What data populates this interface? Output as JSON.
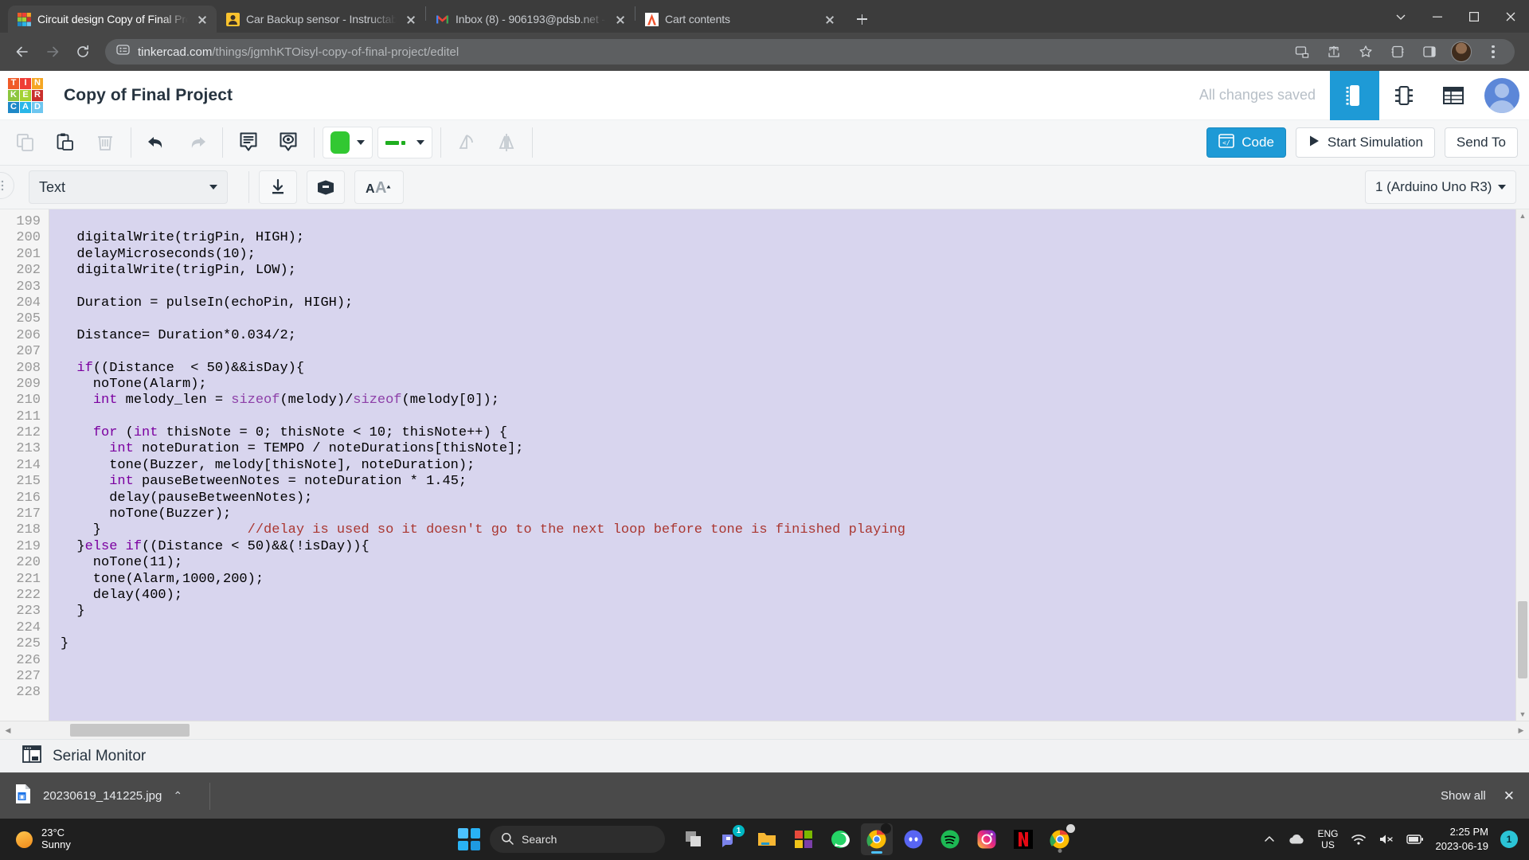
{
  "browser": {
    "tabs": [
      {
        "title": "Circuit design Copy of Final Proj",
        "favicon": "tinkercad-icon",
        "active": true
      },
      {
        "title": "Car Backup sensor - Instructable",
        "favicon": "instructables-icon",
        "active": false
      },
      {
        "title": "Inbox (8) - 906193@pdsb.net - ",
        "favicon": "gmail-icon",
        "active": false
      },
      {
        "title": "Cart contents",
        "favicon": "amazon-icon",
        "active": false
      }
    ],
    "url_domain": "tinkercad.com",
    "url_path": "/things/jgmhKTOisyl-copy-of-final-project/editel",
    "new_tab_label": "+",
    "controls": {
      "minimize": "–",
      "maximize": "□",
      "close": "✕",
      "more": "∨"
    }
  },
  "tinkercad": {
    "logo_letters": [
      "T",
      "I",
      "N",
      "K",
      "E",
      "R",
      "C",
      "A",
      "D"
    ],
    "logo_colors": [
      "#f05a28",
      "#ef3e36",
      "#f5a623",
      "#8cc63e",
      "#a4d233",
      "#c9302c",
      "#1e88c7",
      "#29b6e8",
      "#6ec6f0"
    ],
    "project_title": "Copy of Final Project",
    "save_status": "All changes saved",
    "view_buttons": [
      {
        "name": "components-view",
        "active": true
      },
      {
        "name": "circuit-view",
        "active": false
      },
      {
        "name": "list-view",
        "active": false
      }
    ],
    "toolbar": {
      "copy_label": "Copy",
      "paste_label": "Paste",
      "delete_label": "Delete",
      "undo_label": "Undo",
      "redo_label": "Redo",
      "notes_label": "Notes",
      "visibility_label": "Show/Hide",
      "color_value": "#32c832",
      "wire_color": "#1fae1f",
      "rotate_label": "Rotate",
      "mirror_label": "Mirror",
      "code_label": "Code",
      "start_simulation_label": "Start Simulation",
      "send_to_label": "Send To"
    },
    "code_toolbar": {
      "mode_value": "Text",
      "download_label": "Download Code",
      "library_label": "Libraries",
      "font_size_label": "Font Size",
      "board_value": "1 (Arduino Uno R3)"
    },
    "serial_monitor_label": "Serial Monitor"
  },
  "editor": {
    "accent_bg": "#d8d5ee",
    "first_line": 199,
    "lines": [
      {
        "n": 199,
        "tokens": []
      },
      {
        "n": 200,
        "tokens": [
          {
            "t": "  digitalWrite(trigPin, HIGH);",
            "c": "plain"
          }
        ]
      },
      {
        "n": 201,
        "tokens": [
          {
            "t": "  delayMicroseconds(10);",
            "c": "plain"
          }
        ]
      },
      {
        "n": 202,
        "tokens": [
          {
            "t": "  digitalWrite(trigPin, LOW);",
            "c": "plain"
          }
        ]
      },
      {
        "n": 203,
        "tokens": []
      },
      {
        "n": 204,
        "tokens": [
          {
            "t": "  Duration = pulseIn(echoPin, HIGH);",
            "c": "plain"
          }
        ]
      },
      {
        "n": 205,
        "tokens": []
      },
      {
        "n": 206,
        "tokens": [
          {
            "t": "  Distance= Duration*0.034/2;",
            "c": "plain"
          }
        ]
      },
      {
        "n": 207,
        "tokens": []
      },
      {
        "n": 208,
        "tokens": [
          {
            "t": "  ",
            "c": "plain"
          },
          {
            "t": "if",
            "c": "kw"
          },
          {
            "t": "((Distance  < 50)&&isDay){",
            "c": "plain"
          }
        ]
      },
      {
        "n": 209,
        "tokens": [
          {
            "t": "    noTone(Alarm);",
            "c": "plain"
          }
        ]
      },
      {
        "n": 210,
        "tokens": [
          {
            "t": "    ",
            "c": "plain"
          },
          {
            "t": "int",
            "c": "kw"
          },
          {
            "t": " melody_len = ",
            "c": "plain"
          },
          {
            "t": "sizeof",
            "c": "fn"
          },
          {
            "t": "(melody)",
            "c": "plain"
          },
          {
            "t": "/",
            "c": "plain"
          },
          {
            "t": "sizeof",
            "c": "fn"
          },
          {
            "t": "(melody[0]);",
            "c": "plain"
          }
        ]
      },
      {
        "n": 211,
        "tokens": []
      },
      {
        "n": 212,
        "tokens": [
          {
            "t": "    ",
            "c": "plain"
          },
          {
            "t": "for",
            "c": "kw"
          },
          {
            "t": " (",
            "c": "plain"
          },
          {
            "t": "int",
            "c": "kw"
          },
          {
            "t": " thisNote = 0; thisNote < 10; thisNote++) {",
            "c": "plain"
          }
        ]
      },
      {
        "n": 213,
        "tokens": [
          {
            "t": "      ",
            "c": "plain"
          },
          {
            "t": "int",
            "c": "kw"
          },
          {
            "t": " noteDuration = TEMPO / noteDurations[thisNote];",
            "c": "plain"
          }
        ]
      },
      {
        "n": 214,
        "tokens": [
          {
            "t": "      tone(Buzzer, melody[thisNote], noteDuration);",
            "c": "plain"
          }
        ]
      },
      {
        "n": 215,
        "tokens": [
          {
            "t": "      ",
            "c": "plain"
          },
          {
            "t": "int",
            "c": "kw"
          },
          {
            "t": " pauseBetweenNotes = noteDuration * 1.45;",
            "c": "plain"
          }
        ]
      },
      {
        "n": 216,
        "tokens": [
          {
            "t": "      delay(pauseBetweenNotes);",
            "c": "plain"
          }
        ]
      },
      {
        "n": 217,
        "tokens": [
          {
            "t": "      noTone(Buzzer);",
            "c": "plain"
          }
        ]
      },
      {
        "n": 218,
        "tokens": [
          {
            "t": "    }                  ",
            "c": "plain"
          },
          {
            "t": "//delay is used so it doesn't go to the next loop before tone is finished playing",
            "c": "cmt"
          }
        ]
      },
      {
        "n": 219,
        "tokens": [
          {
            "t": "  }",
            "c": "plain"
          },
          {
            "t": "else",
            "c": "kw"
          },
          {
            "t": " ",
            "c": "plain"
          },
          {
            "t": "if",
            "c": "kw"
          },
          {
            "t": "((Distance < 50)&&(!isDay)){",
            "c": "plain"
          }
        ]
      },
      {
        "n": 220,
        "tokens": [
          {
            "t": "    noTone(11);",
            "c": "plain"
          }
        ]
      },
      {
        "n": 221,
        "tokens": [
          {
            "t": "    tone(Alarm,1000,200);",
            "c": "plain"
          }
        ]
      },
      {
        "n": 222,
        "tokens": [
          {
            "t": "    delay(400);",
            "c": "plain"
          }
        ]
      },
      {
        "n": 223,
        "tokens": [
          {
            "t": "  }",
            "c": "plain"
          }
        ]
      },
      {
        "n": 224,
        "tokens": []
      },
      {
        "n": 225,
        "tokens": [
          {
            "t": "}",
            "c": "plain"
          }
        ]
      },
      {
        "n": 226,
        "tokens": []
      },
      {
        "n": 227,
        "tokens": []
      },
      {
        "n": 228,
        "tokens": []
      }
    ]
  },
  "download_shelf": {
    "file_name": "20230619_141225.jpg",
    "expand_label": "⌃",
    "show_all_label": "Show all",
    "close_label": "✕"
  },
  "taskbar": {
    "weather_temp": "23°C",
    "weather_desc": "Sunny",
    "search_placeholder": "Search",
    "apps": [
      {
        "name": "task-view",
        "badge": ""
      },
      {
        "name": "teams",
        "badge": "1"
      },
      {
        "name": "file-explorer",
        "badge": ""
      },
      {
        "name": "microsoft-store",
        "badge": ""
      },
      {
        "name": "whatsapp",
        "badge": ""
      },
      {
        "name": "chrome",
        "badge": ""
      },
      {
        "name": "discord",
        "badge": ""
      },
      {
        "name": "spotify",
        "badge": ""
      },
      {
        "name": "instagram",
        "badge": ""
      },
      {
        "name": "netflix",
        "badge": ""
      },
      {
        "name": "chrome-2",
        "badge": ""
      }
    ],
    "language": "ENG",
    "region": "US",
    "time": "2:25 PM",
    "date": "2023-06-19",
    "notification_count": "1"
  }
}
